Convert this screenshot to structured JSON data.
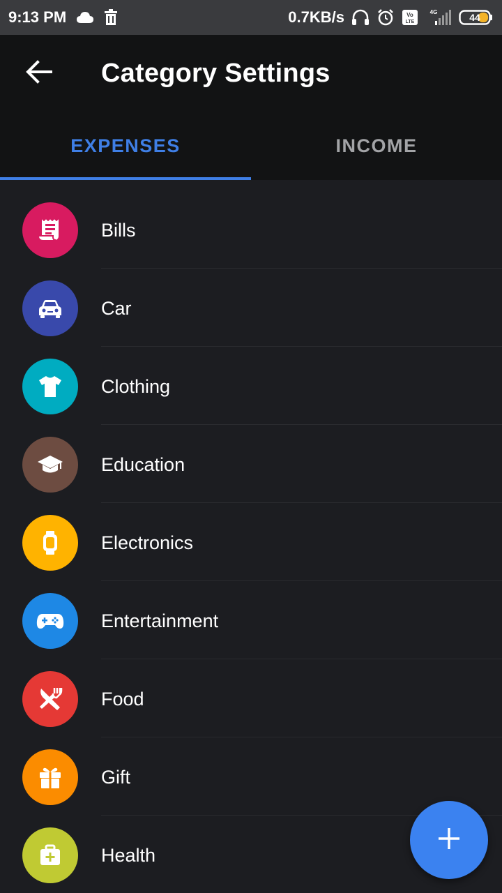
{
  "status_bar": {
    "time": "9:13 PM",
    "net_speed": "0.7KB/s",
    "signal_label": "4G",
    "battery": "44",
    "volte_label": "Vo LTE"
  },
  "app_bar": {
    "title": "Category Settings",
    "back_icon": "arrow-left-icon"
  },
  "tabs": [
    {
      "label": "EXPENSES",
      "active": true
    },
    {
      "label": "INCOME",
      "active": false
    }
  ],
  "categories": [
    {
      "label": "Bills",
      "icon": "receipt-icon",
      "color": "#d81b60"
    },
    {
      "label": "Car",
      "icon": "car-icon",
      "color": "#3949ab"
    },
    {
      "label": "Clothing",
      "icon": "tshirt-icon",
      "color": "#00acc1"
    },
    {
      "label": "Education",
      "icon": "graduation-cap-icon",
      "color": "#6d4c41"
    },
    {
      "label": "Electronics",
      "icon": "smartwatch-icon",
      "color": "#ffb300"
    },
    {
      "label": "Entertainment",
      "icon": "gamepad-icon",
      "color": "#1e88e5"
    },
    {
      "label": "Food",
      "icon": "utensils-icon",
      "color": "#e53935"
    },
    {
      "label": "Gift",
      "icon": "gift-icon",
      "color": "#fb8c00"
    },
    {
      "label": "Health",
      "icon": "first-aid-kit-icon",
      "color": "#c0ca33"
    }
  ],
  "fab": {
    "icon": "plus-icon",
    "color": "#3b82f0"
  },
  "colors": {
    "accent": "#3f7fe6",
    "background": "#1c1d21",
    "bar": "#121314"
  }
}
